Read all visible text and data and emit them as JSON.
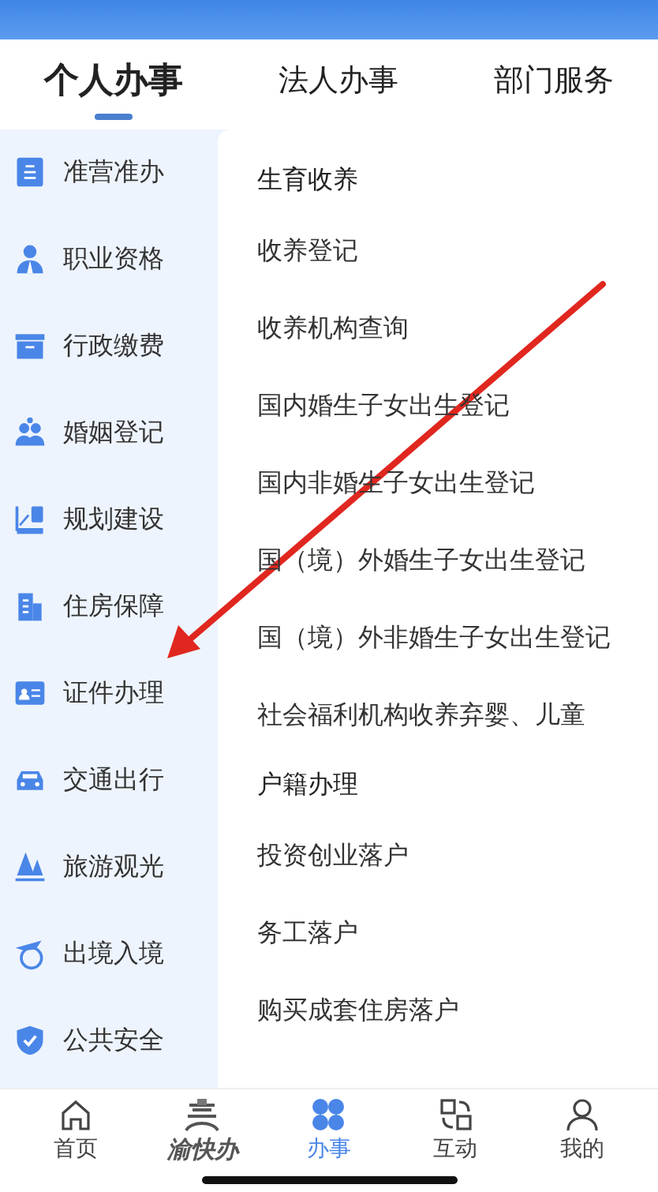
{
  "tabs": [
    {
      "label": "个人办事",
      "selected": true
    },
    {
      "label": "法人办事",
      "selected": false
    },
    {
      "label": "部门服务",
      "selected": false
    }
  ],
  "sidebar": {
    "items": [
      {
        "label": "准营准办"
      },
      {
        "label": "职业资格"
      },
      {
        "label": "行政缴费"
      },
      {
        "label": "婚姻登记"
      },
      {
        "label": "规划建设"
      },
      {
        "label": "住房保障"
      },
      {
        "label": "证件办理"
      },
      {
        "label": "交通出行"
      },
      {
        "label": "旅游观光"
      },
      {
        "label": "出境入境"
      },
      {
        "label": "公共安全"
      }
    ]
  },
  "sections": [
    {
      "title": "生育收养",
      "items": [
        "收养登记",
        "收养机构查询",
        "国内婚生子女出生登记",
        "国内非婚生子女出生登记",
        "国（境）外婚生子女出生登记",
        "国（境）外非婚生子女出生登记",
        "社会福利机构收养弃婴、儿童"
      ]
    },
    {
      "title": "户籍办理",
      "items": [
        "投资创业落户",
        "务工落户",
        "购买成套住房落户"
      ]
    }
  ],
  "bottom_nav": [
    {
      "kind": "tab",
      "label": "首页",
      "selected": false
    },
    {
      "kind": "logo",
      "label": "渝快办"
    },
    {
      "kind": "tab",
      "label": "办事",
      "selected": true
    },
    {
      "kind": "tab",
      "label": "互动",
      "selected": false
    },
    {
      "kind": "tab",
      "label": "我的",
      "selected": false
    }
  ]
}
